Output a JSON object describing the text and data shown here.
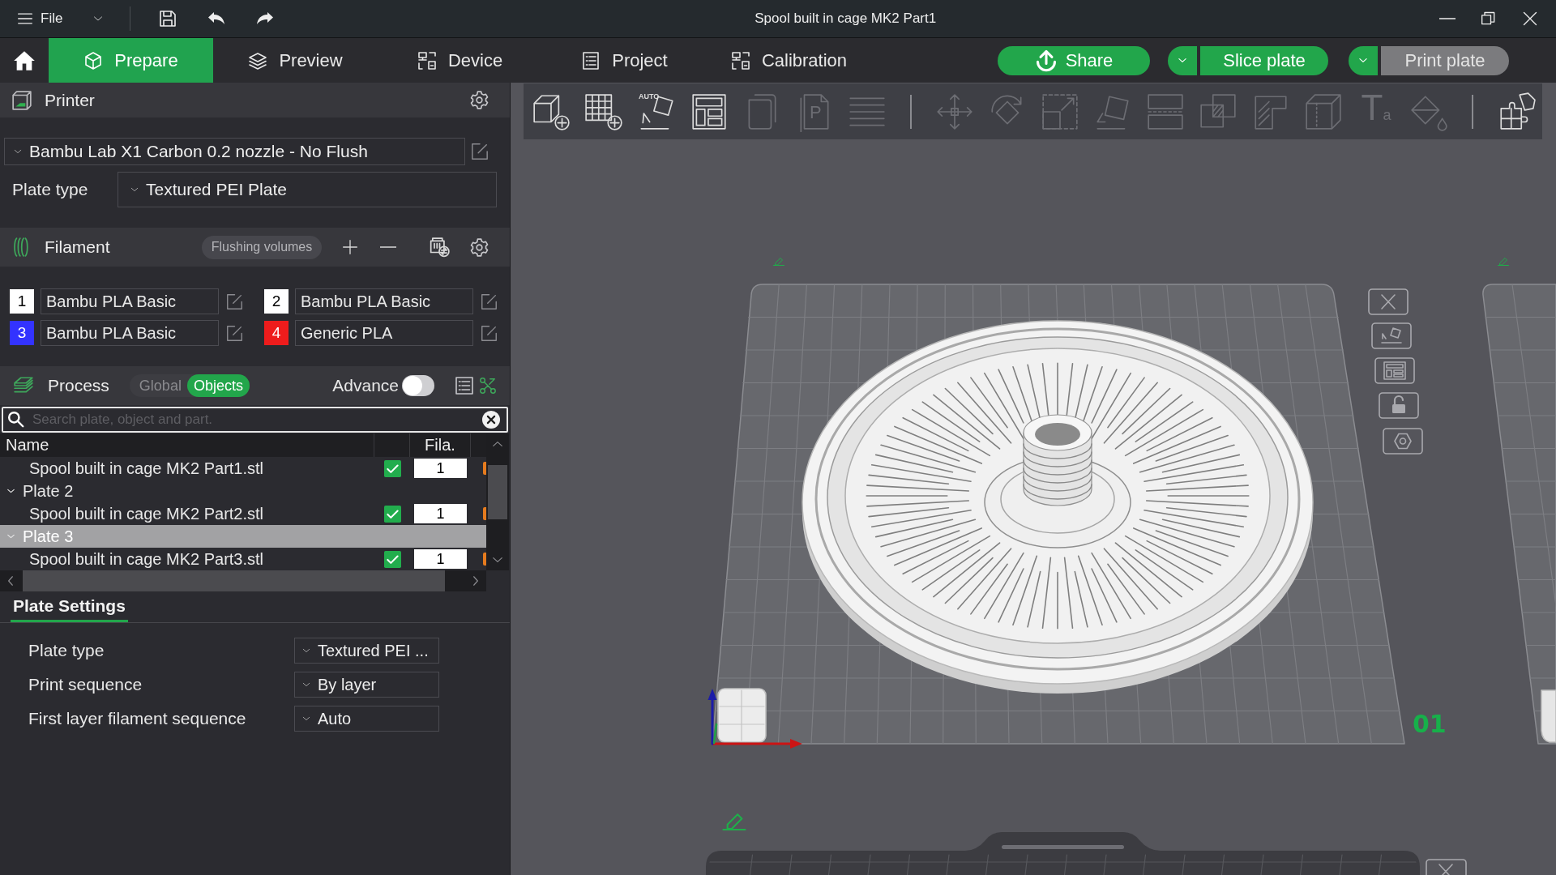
{
  "window": {
    "title": "Spool built in cage MK2 Part1",
    "menu": "File"
  },
  "tabs": [
    {
      "label": "Prepare",
      "kind": "prepare",
      "selected": true
    },
    {
      "label": "Preview",
      "kind": "preview",
      "selected": false
    },
    {
      "label": "Device",
      "kind": "device",
      "selected": false
    },
    {
      "label": "Project",
      "kind": "project",
      "selected": false
    },
    {
      "label": "Calibration",
      "kind": "calibration",
      "selected": false
    }
  ],
  "actions": [
    {
      "label": "Share",
      "kind": "share",
      "disabled": false
    },
    {
      "label": "Slice plate",
      "kind": "dropdown",
      "disabled": false
    },
    {
      "label": "Print plate",
      "kind": "dropdown",
      "disabled": true
    }
  ],
  "printer": {
    "title": "Printer",
    "preset": "Bambu Lab X1 Carbon 0.2 nozzle - No Flush",
    "plate_type_label": "Plate type",
    "plate_type": "Textured PEI Plate"
  },
  "filament": {
    "title": "Filament",
    "flushing_button": "Flushing volumes",
    "slots": [
      {
        "number": "1",
        "name": "Bambu PLA Basic",
        "color": "#ffffff"
      },
      {
        "number": "2",
        "name": "Bambu PLA Basic",
        "color": "#ffffff"
      },
      {
        "number": "3",
        "name": "Bambu PLA Basic",
        "color": "#3333ff"
      },
      {
        "number": "4",
        "name": "Generic PLA",
        "color": "#ee1c1c"
      }
    ]
  },
  "process": {
    "title": "Process",
    "modes": [
      {
        "label": "Global",
        "selected": false
      },
      {
        "label": "Objects",
        "selected": true
      }
    ],
    "advance_label": "Advance",
    "advance_on": false
  },
  "object_list": {
    "search_placeholder": "Search plate, object and part.",
    "columns": [
      {
        "kind": "name",
        "label": "Name"
      },
      {
        "kind": "check"
      },
      {
        "kind": "filament",
        "label": "Fila."
      },
      {
        "kind": "extra"
      }
    ],
    "rows": [
      {
        "kind": "object",
        "name": "Spool built in cage MK2 Part1.stl",
        "checked": true,
        "filament": "1",
        "selected": false
      },
      {
        "kind": "plate",
        "name": "Plate 2",
        "expanded": true,
        "selected": false,
        "children": [
          {
            "kind": "object",
            "name": "Spool built in cage MK2 Part2.stl",
            "checked": true,
            "filament": "1",
            "selected": false
          }
        ]
      },
      {
        "kind": "plate",
        "name": "Plate 3",
        "expanded": true,
        "selected": true,
        "children": [
          {
            "kind": "object",
            "name": "Spool built in cage MK2 Part3.stl",
            "checked": true,
            "filament": "1",
            "selected": false
          }
        ]
      }
    ]
  },
  "plate_settings": {
    "tabs": [
      {
        "label": "Plate Settings",
        "selected": true
      }
    ],
    "fields": [
      {
        "label": "Plate type",
        "value": "Textured PEI ..."
      },
      {
        "label": "Print sequence",
        "value": "By layer"
      },
      {
        "label": "First layer filament sequence",
        "value": "Auto"
      }
    ]
  },
  "toolbar": {
    "groups": [
      [
        {
          "kind": "addpart",
          "disabled": false
        },
        {
          "kind": "addplate",
          "disabled": false
        },
        {
          "kind": "orient",
          "glyph": "AUTO",
          "disabled": false
        },
        {
          "kind": "arrange",
          "disabled": false
        },
        {
          "kind": "copy",
          "disabled": true
        },
        {
          "kind": "paste",
          "glyph": "P",
          "disabled": true
        },
        {
          "kind": "layers",
          "disabled": true
        }
      ],
      [
        {
          "kind": "move",
          "disabled": true
        },
        {
          "kind": "rotate",
          "disabled": true
        },
        {
          "kind": "scale",
          "disabled": true
        },
        {
          "kind": "layface",
          "disabled": true
        },
        {
          "kind": "cut",
          "disabled": true
        },
        {
          "kind": "boolean",
          "disabled": true
        },
        {
          "kind": "support",
          "disabled": true
        },
        {
          "kind": "seam",
          "disabled": true
        },
        {
          "kind": "text",
          "glyph": "Ta",
          "disabled": true
        },
        {
          "kind": "paint",
          "disabled": true
        }
      ],
      [
        {
          "kind": "assembly",
          "disabled": false
        }
      ]
    ]
  },
  "canvas": {
    "plate_number": "01",
    "plate_locked": false
  }
}
